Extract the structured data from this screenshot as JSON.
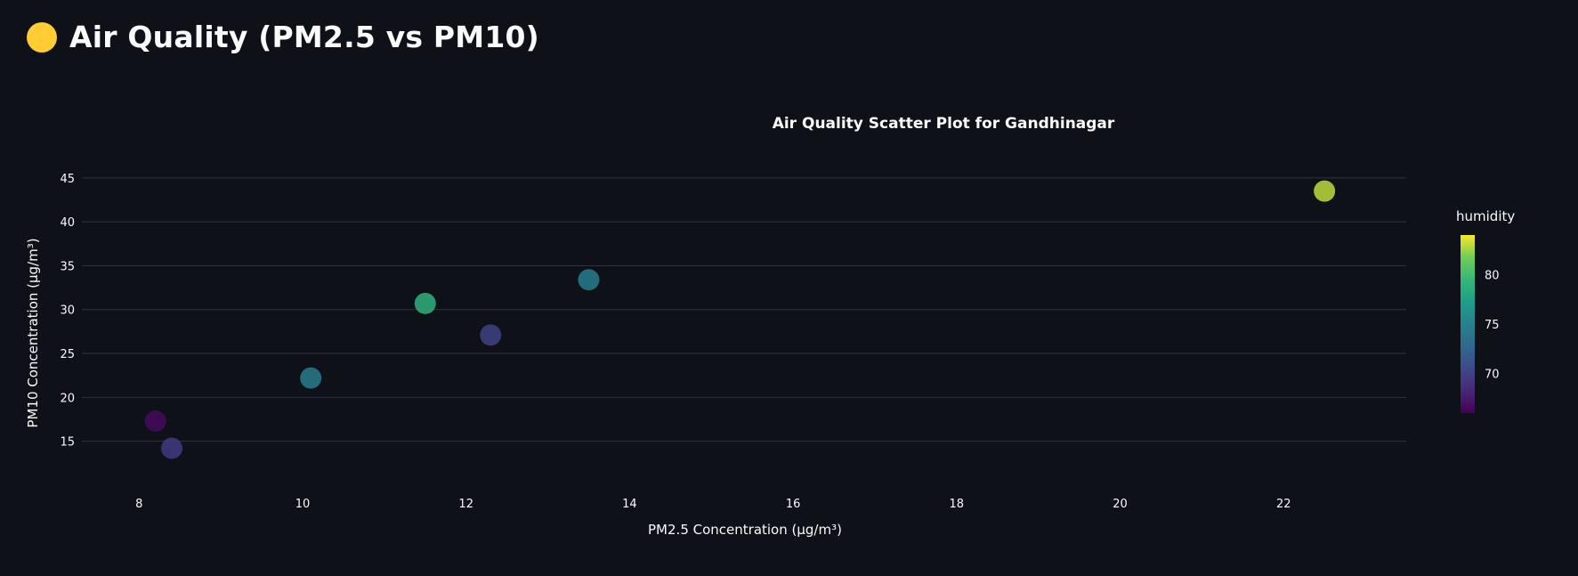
{
  "header": {
    "emoji_icon": "yellow-circle-icon",
    "title": "Air Quality (PM2.5 vs PM10)"
  },
  "colors": {
    "background": "#0e1117",
    "text": "#fafafa",
    "grid": "#31333f",
    "emoji": "#ffcc33"
  },
  "chart_data": {
    "type": "scatter",
    "title": "Air Quality Scatter Plot for Gandhinagar",
    "xlabel": "PM2.5 Concentration (µg/m³)",
    "ylabel": "PM10 Concentration (µg/m³)",
    "xlim": [
      7.3,
      23.5
    ],
    "ylim": [
      10.5,
      46
    ],
    "x_ticks": [
      8,
      10,
      12,
      14,
      16,
      18,
      20,
      22
    ],
    "y_ticks": [
      15,
      20,
      25,
      30,
      35,
      40,
      45
    ],
    "grid": "horizontal",
    "color_variable": "humidity",
    "colorscale": "viridis",
    "color_range": [
      66,
      84
    ],
    "colorbar_ticks": [
      70,
      75,
      80
    ],
    "colorbar_title": "humidity",
    "points": [
      {
        "x": 8.2,
        "y": 17.3,
        "humidity": 66.5
      },
      {
        "x": 8.4,
        "y": 14.2,
        "humidity": 69.5
      },
      {
        "x": 10.1,
        "y": 22.2,
        "humidity": 74.5
      },
      {
        "x": 11.5,
        "y": 30.7,
        "humidity": 79.0
      },
      {
        "x": 12.3,
        "y": 27.1,
        "humidity": 70.0
      },
      {
        "x": 13.5,
        "y": 33.4,
        "humidity": 74.5
      },
      {
        "x": 22.5,
        "y": 43.5,
        "humidity": 83.0
      }
    ]
  }
}
